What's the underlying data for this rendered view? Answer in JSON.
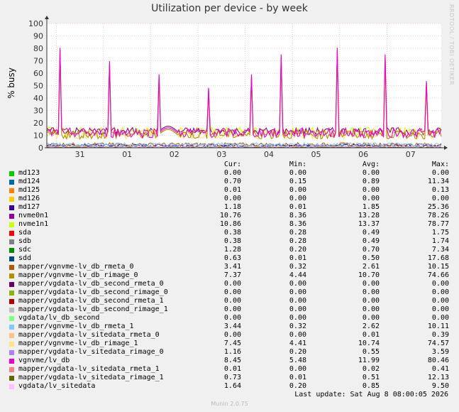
{
  "chart_data": {
    "type": "line",
    "title": "Utilization per device - by week",
    "ylabel": "% busy",
    "ylim": [
      0,
      100
    ],
    "yticks": [
      "0",
      "10",
      "20",
      "30",
      "40",
      "50",
      "60",
      "70",
      "80",
      "90",
      "100"
    ],
    "xticks": [
      "31",
      "01",
      "02",
      "03",
      "04",
      "05",
      "06",
      "07"
    ],
    "grid": true,
    "watermark": "RRDTOOL / TOBI OETIKER",
    "columns": [
      "Cur:",
      "Min:",
      "Avg:",
      "Max:"
    ],
    "series": [
      {
        "name": "md123",
        "color": "#00cc00",
        "cur": "0.00",
        "min": "0.00",
        "avg": "0.00",
        "max": "0.00"
      },
      {
        "name": "md124",
        "color": "#0066b3",
        "cur": "0.70",
        "min": "0.15",
        "avg": "0.89",
        "max": "11.34"
      },
      {
        "name": "md125",
        "color": "#ff8000",
        "cur": "0.01",
        "min": "0.00",
        "avg": "0.00",
        "max": "0.13"
      },
      {
        "name": "md126",
        "color": "#ffcc00",
        "cur": "0.00",
        "min": "0.00",
        "avg": "0.00",
        "max": "0.00"
      },
      {
        "name": "md127",
        "color": "#330099",
        "cur": "1.18",
        "min": "0.01",
        "avg": "1.85",
        "max": "25.36"
      },
      {
        "name": "nvme0n1",
        "color": "#990099",
        "cur": "10.76",
        "min": "8.36",
        "avg": "13.28",
        "max": "78.26"
      },
      {
        "name": "nvme1n1",
        "color": "#ccff00",
        "cur": "10.86",
        "min": "8.36",
        "avg": "13.37",
        "max": "78.77"
      },
      {
        "name": "sda",
        "color": "#ff0000",
        "cur": "0.38",
        "min": "0.28",
        "avg": "0.49",
        "max": "1.75"
      },
      {
        "name": "sdb",
        "color": "#808080",
        "cur": "0.38",
        "min": "0.28",
        "avg": "0.49",
        "max": "1.74"
      },
      {
        "name": "sdc",
        "color": "#008f00",
        "cur": "1.28",
        "min": "0.20",
        "avg": "0.70",
        "max": "7.34"
      },
      {
        "name": "sdd",
        "color": "#00487d",
        "cur": "0.63",
        "min": "0.01",
        "avg": "0.50",
        "max": "17.68"
      },
      {
        "name": "mapper/vgnvme-lv_db_rmeta_0",
        "color": "#b35a00",
        "cur": "3.41",
        "min": "0.32",
        "avg": "2.61",
        "max": "10.15"
      },
      {
        "name": "mapper/vgnvme-lv_db_rimage_0",
        "color": "#b38f00",
        "cur": "7.37",
        "min": "4.44",
        "avg": "10.70",
        "max": "74.66"
      },
      {
        "name": "mapper/vgdata-lv_db_second_rmeta_0",
        "color": "#6b006b",
        "cur": "0.00",
        "min": "0.00",
        "avg": "0.00",
        "max": "0.00"
      },
      {
        "name": "mapper/vgdata-lv_db_second_rimage_0",
        "color": "#8fb300",
        "cur": "0.00",
        "min": "0.00",
        "avg": "0.00",
        "max": "0.00"
      },
      {
        "name": "mapper/vgdata-lv_db_second_rmeta_1",
        "color": "#b30000",
        "cur": "0.00",
        "min": "0.00",
        "avg": "0.00",
        "max": "0.00"
      },
      {
        "name": "mapper/vgdata-lv_db_second_rimage_1",
        "color": "#bebebe",
        "cur": "0.00",
        "min": "0.00",
        "avg": "0.00",
        "max": "0.00"
      },
      {
        "name": "vgdata/lv_db_second",
        "color": "#80ff80",
        "cur": "0.00",
        "min": "0.00",
        "avg": "0.00",
        "max": "0.00"
      },
      {
        "name": "mapper/vgnvme-lv_db_rmeta_1",
        "color": "#80c9ff",
        "cur": "3.44",
        "min": "0.32",
        "avg": "2.62",
        "max": "10.11"
      },
      {
        "name": "mapper/vgdata-lv_sitedata_rmeta_0",
        "color": "#ffc080",
        "cur": "0.00",
        "min": "0.00",
        "avg": "0.01",
        "max": "0.39"
      },
      {
        "name": "mapper/vgnvme-lv_db_rimage_1",
        "color": "#ffe680",
        "cur": "7.45",
        "min": "4.41",
        "avg": "10.74",
        "max": "74.57"
      },
      {
        "name": "mapper/vgdata-lv_sitedata_rimage_0",
        "color": "#aa80ff",
        "cur": "1.16",
        "min": "0.20",
        "avg": "0.55",
        "max": "3.59"
      },
      {
        "name": "vgnvme/lv_db",
        "color": "#ee00cc",
        "cur": "8.45",
        "min": "5.48",
        "avg": "11.99",
        "max": "80.46"
      },
      {
        "name": "mapper/vgdata-lv_sitedata_rmeta_1",
        "color": "#ff8080",
        "cur": "0.01",
        "min": "0.00",
        "avg": "0.02",
        "max": "0.41"
      },
      {
        "name": "mapper/vgdata-lv_sitedata_rimage_1",
        "color": "#666600",
        "cur": "0.73",
        "min": "0.01",
        "avg": "0.51",
        "max": "12.13"
      },
      {
        "name": "vgdata/lv_sitedata",
        "color": "#ffbfff",
        "cur": "1.64",
        "min": "0.20",
        "avg": "0.85",
        "max": "9.50"
      }
    ]
  },
  "last_update": "Last update: Sat Aug  8 08:00:05 2026",
  "footer": "Munin 2.0.75"
}
